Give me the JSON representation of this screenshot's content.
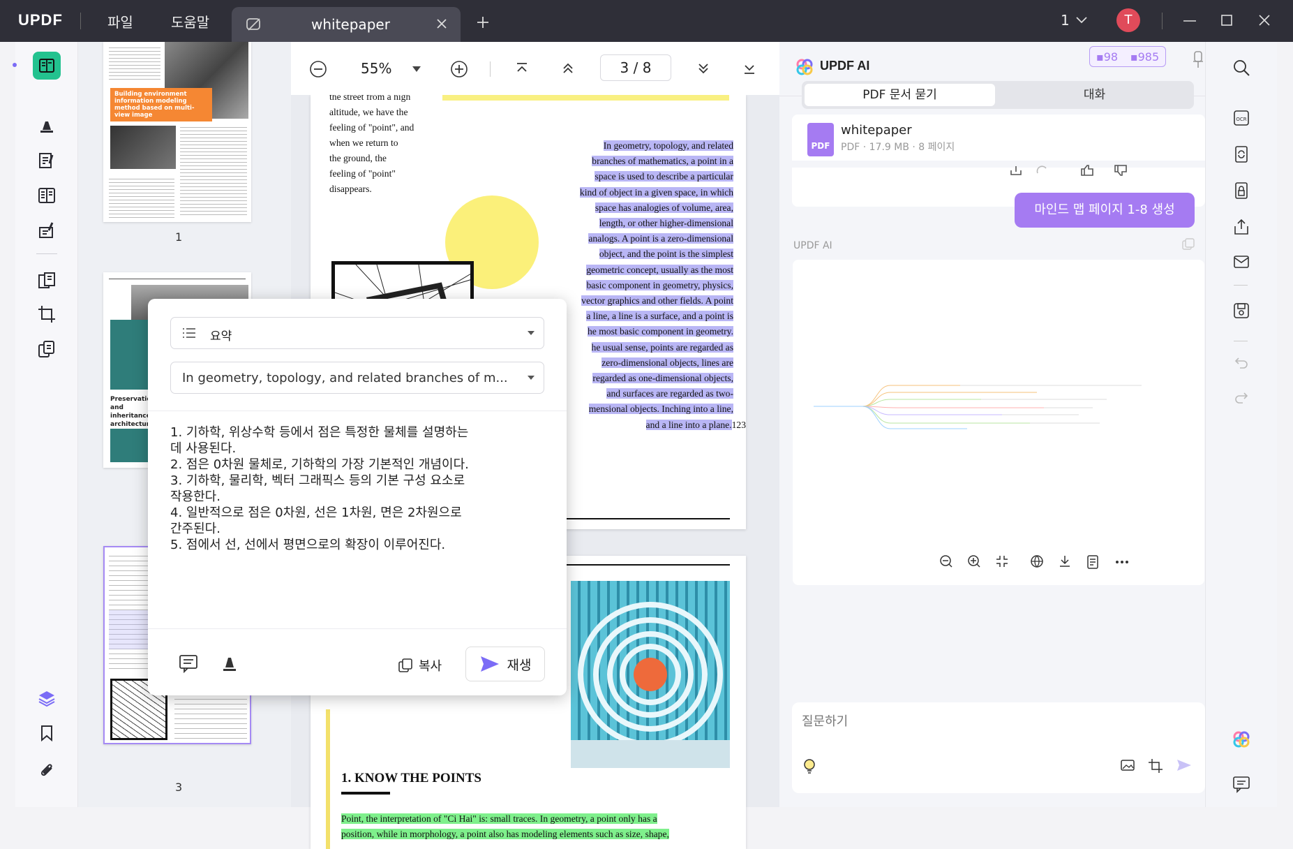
{
  "titlebar": {
    "logo": "UPDF",
    "menu_file": "파일",
    "menu_help": "도움말",
    "tab_title": "whitepaper",
    "page_count_label": "1",
    "avatar_letter": "T"
  },
  "viewer_toolbar": {
    "zoom": "55%",
    "current_page": "3",
    "page_sep": "/",
    "total_pages": "8"
  },
  "thumbnails": [
    {
      "label": "1",
      "heading": "Building environment information modeling method based on multi-view image"
    },
    {
      "label": "",
      "heading": "Preservation and inheritance architecture dimension"
    },
    {
      "label": "3"
    }
  ],
  "document": {
    "intro_lines": [
      "the street from a high",
      "altitude, we have the",
      "feeling of \"point\", and",
      "when we return to",
      "the ground, the",
      "feeling of \"point\"",
      "disappears."
    ],
    "highlight_lines": [
      "In geometry, topology, and related",
      "branches of mathematics, a point in a",
      "space is used to describe a particular",
      "kind of object in a given space, in which",
      "space has analogies of volume, area,",
      "length, or other higher-dimensional",
      "analogs. A point is a zero-dimensional",
      "object, and the point is the simplest",
      "geometric concept, usually as the most",
      "basic component in geometry, physics,",
      "vector graphics and other fields. A point",
      "a line, a line is a surface, and a point is",
      "he most basic component in geometry.",
      "he usual sense, points are regarded as",
      "zero-dimensional objects, lines are",
      "regarded as one-dimensional objects,",
      "and surfaces are regarded as two-",
      "mensional objects. Inching into a line,",
      "and a line into a plane."
    ],
    "footnote": "123",
    "section_heading": "1. KNOW THE POINTS",
    "green_lines": [
      "Point, the interpretation of \"Ci Hai\" is: small traces. In geometry, a point only has a",
      "position, while in morphology, a point also has modeling elements such as size, shape,"
    ]
  },
  "popup": {
    "mode_label": "요약",
    "source_text": "In geometry, topology, and related branches of m...",
    "result_lines": [
      "1. 기하학, 위상수학 등에서 점은 특정한 물체를 설명하는",
      "데 사용된다.",
      "2. 점은 0차원 물체로, 기하학의 가장 기본적인 개념이다.",
      "3. 기하학, 물리학, 벡터 그래픽스 등의 기본 구성 요소로",
      "작용한다.",
      "4. 일반적으로 점은 0차원, 선은 1차원, 면은 2차원으로",
      "간주된다.",
      "5. 점에서 선, 선에서 평면으로의 확장이 이루어진다."
    ],
    "copy_label": "복사",
    "regenerate_label": "재생"
  },
  "ai_panel": {
    "title": "UPDF AI",
    "credit_a": "98",
    "credit_b": "985",
    "tab_pdf": "PDF 문서 묻기",
    "tab_chat": "대화",
    "file_name": "whitepaper",
    "file_meta": "PDF · 17.9 MB · 8 페이지",
    "file_badge": "PDF",
    "user_message": "마인드 맵 페이지 1-8 생성",
    "ai_label": "UPDF AI",
    "input_placeholder": "질문하기"
  },
  "colors": {
    "accent": "#a57bf2",
    "highlight_purple": "#b9b6f5",
    "highlight_green": "#7ff08c",
    "brand_yellow": "#f7c948",
    "titlebar": "#2f2f38"
  },
  "icons": [
    "annotate-icon",
    "highlight-icon",
    "edit-icon",
    "reader-icon",
    "form-icon",
    "organize-icon",
    "crop-icon",
    "compress-icon",
    "layers-icon",
    "bookmark-icon",
    "attachment-icon",
    "search-icon",
    "ocr-icon",
    "convert-icon",
    "protect-icon",
    "share-icon",
    "mail-icon",
    "save-icon",
    "undo-icon",
    "redo-icon",
    "ai-icon",
    "comment-icon"
  ]
}
